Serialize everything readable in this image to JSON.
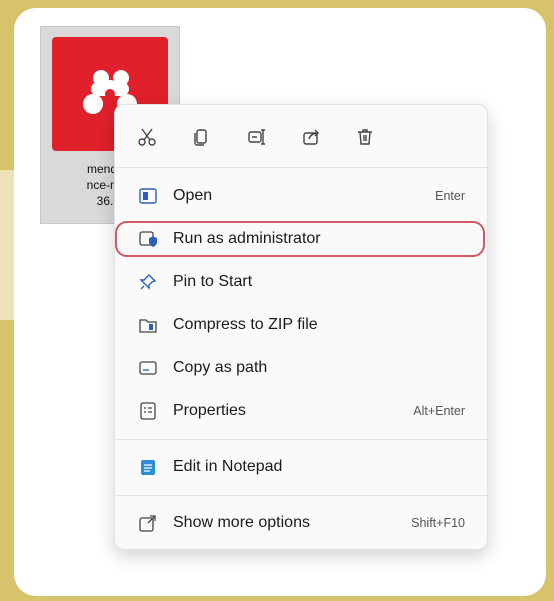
{
  "file": {
    "name_lines": [
      "mendele",
      "nce-man",
      "36.0."
    ]
  },
  "toolbar": {
    "icons": [
      "cut-icon",
      "copy-icon",
      "rename-icon",
      "share-icon",
      "delete-icon"
    ]
  },
  "menu": {
    "open": {
      "label": "Open",
      "shortcut": "Enter"
    },
    "run_admin": {
      "label": "Run as administrator"
    },
    "pin_start": {
      "label": "Pin to Start"
    },
    "compress_zip": {
      "label": "Compress to ZIP file"
    },
    "copy_path": {
      "label": "Copy as path"
    },
    "properties": {
      "label": "Properties",
      "shortcut": "Alt+Enter"
    },
    "edit_notepad": {
      "label": "Edit in Notepad"
    },
    "more_options": {
      "label": "Show more options",
      "shortcut": "Shift+F10"
    }
  },
  "colors": {
    "highlight_border": "#cf5a66",
    "icon_blue": "#2b5fb8",
    "app_red": "#e0202a"
  }
}
